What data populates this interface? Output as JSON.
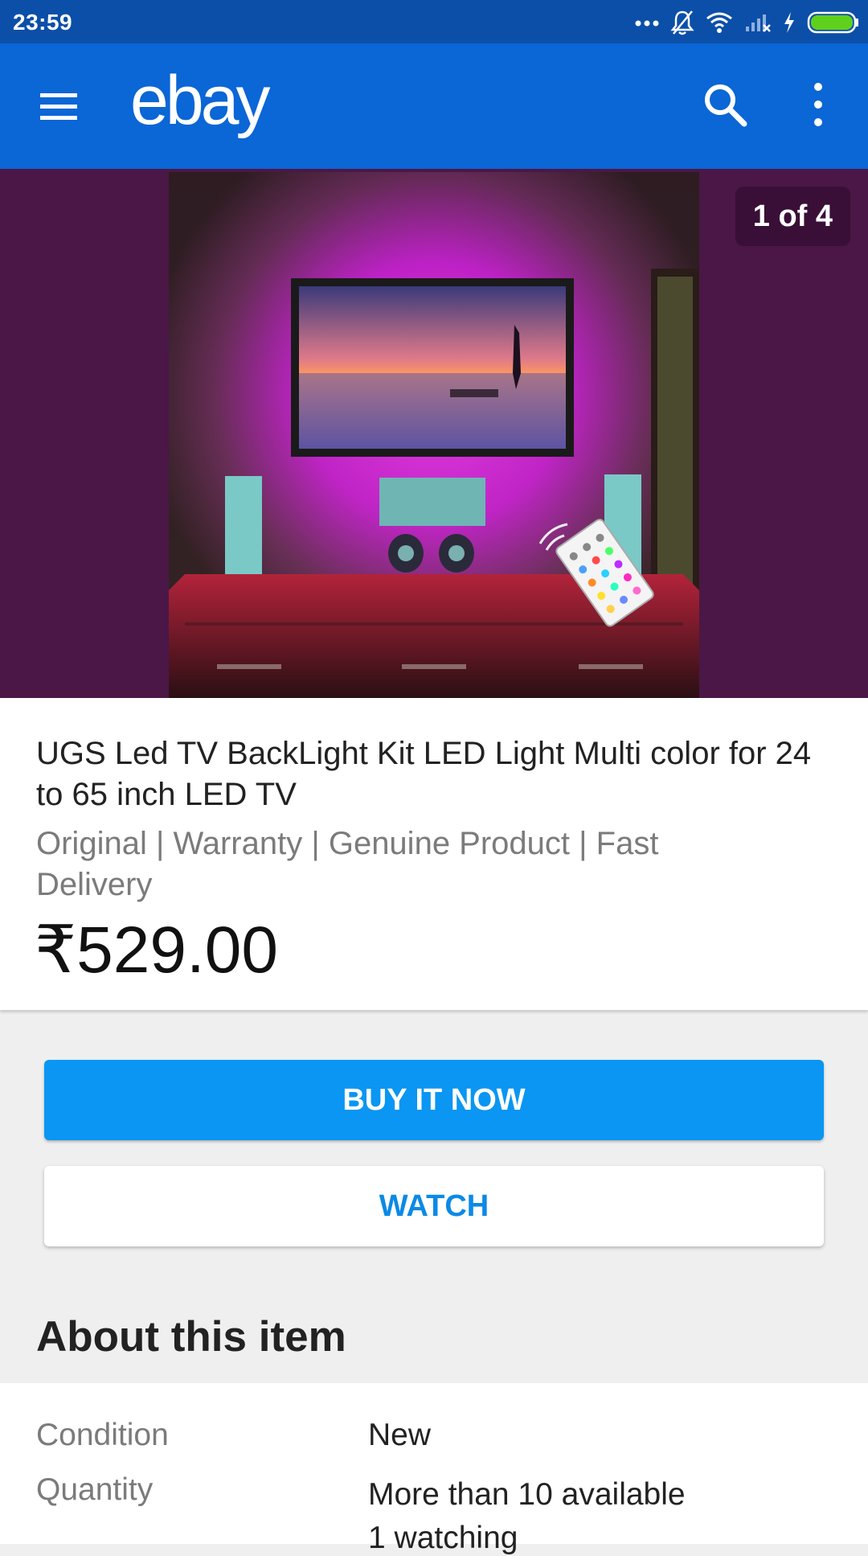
{
  "status_bar": {
    "time": "23:59"
  },
  "app_bar": {
    "logo": "ebay",
    "icons": [
      "menu-icon",
      "search-icon",
      "more-vert-icon"
    ]
  },
  "gallery": {
    "counter": "1 of 4"
  },
  "item": {
    "title": "UGS Led TV BackLight Kit LED Light Multi color for 24 to 65 inch LED TV",
    "subtitle": "Original | Warranty | Genuine Product | Fast Delivery",
    "price": "₹529.00"
  },
  "actions": {
    "buy_label": "BUY IT NOW",
    "watch_label": "WATCH"
  },
  "about": {
    "heading": "About this item",
    "rows": [
      {
        "label": "Condition",
        "value": "New"
      },
      {
        "label": "Quantity",
        "value": "More than 10 available",
        "extra": "1 watching"
      }
    ]
  },
  "colors": {
    "status_bar": "#0b4fa9",
    "app_bar": "#0b66d6",
    "buy_button": "#0a96f2",
    "watch_text": "#0a8ae6",
    "hero_bg": "#4a1747"
  }
}
